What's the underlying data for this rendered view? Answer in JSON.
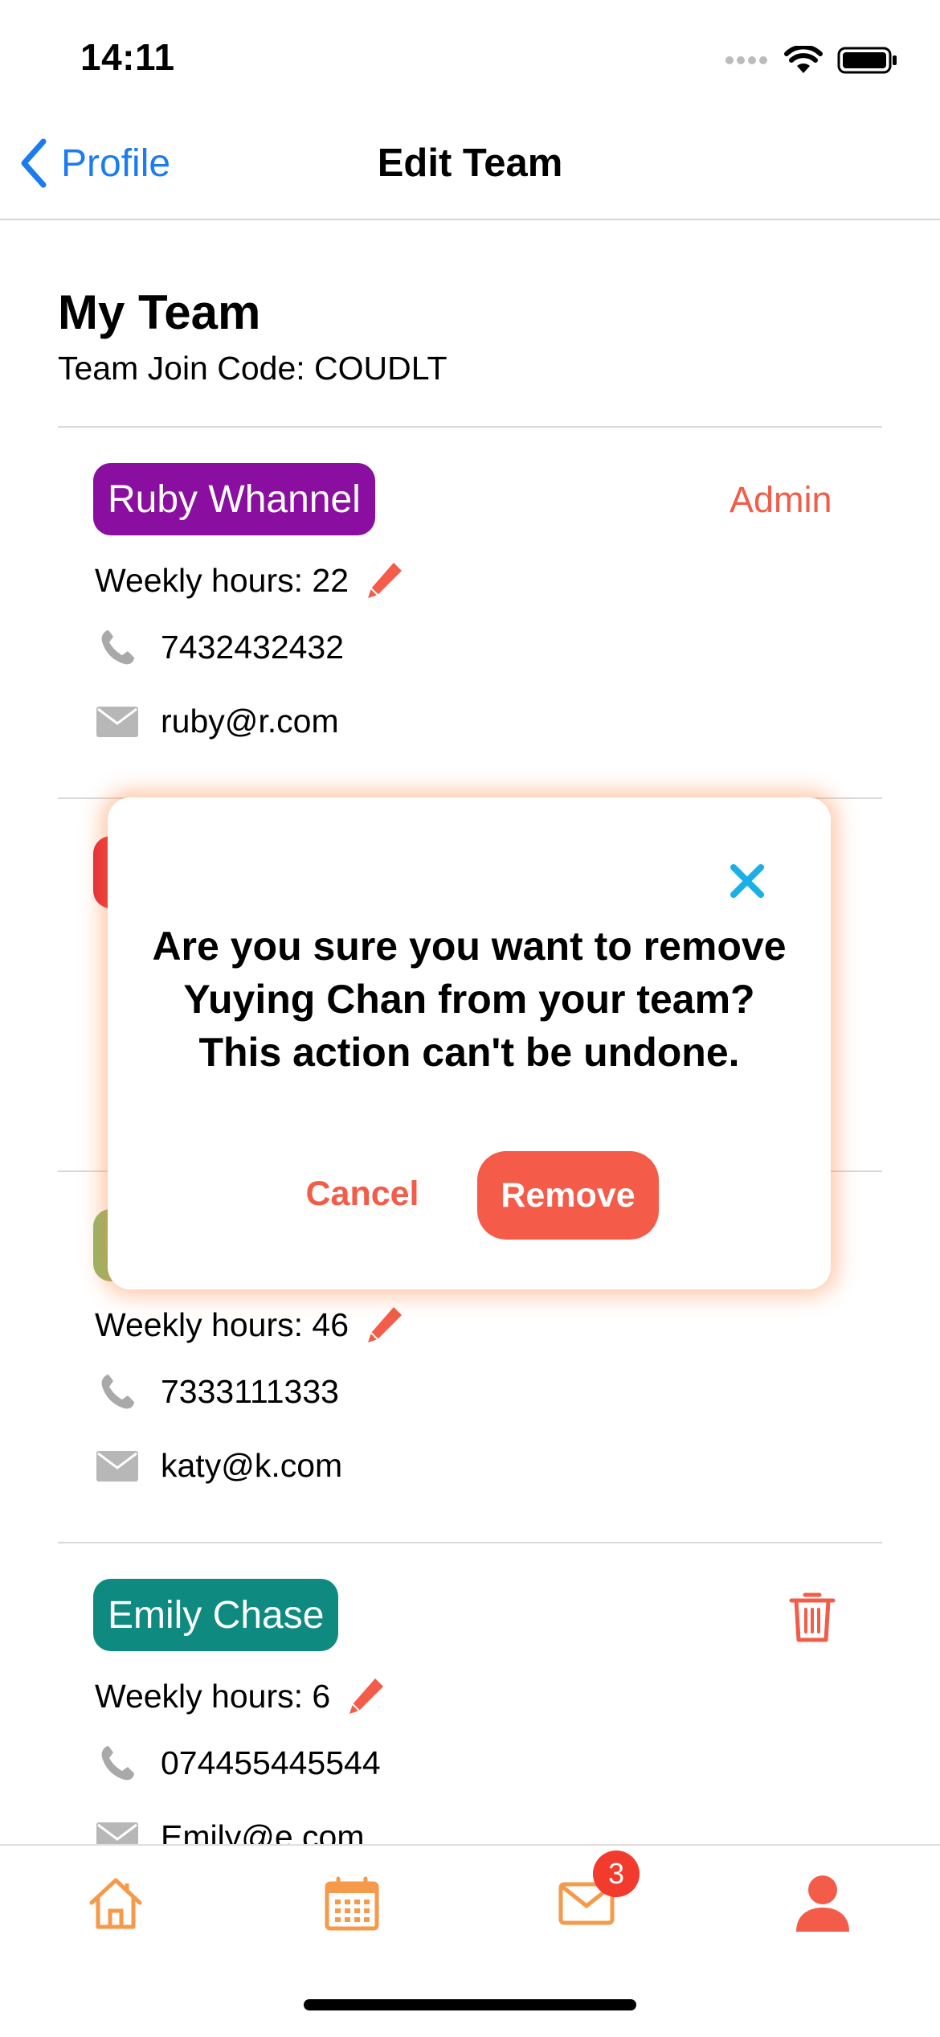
{
  "status_bar": {
    "time": "14:11"
  },
  "nav": {
    "back_label": "Profile",
    "title": "Edit Team"
  },
  "team": {
    "title": "My Team",
    "join_code": "Team Join Code: COUDLT"
  },
  "members": [
    {
      "name": "Ruby Whannel",
      "color": "#8a0fa0",
      "role": "Admin",
      "hours": "Weekly hours: 22",
      "phone": "7432432432",
      "email": "ruby@r.com"
    },
    {
      "name": "",
      "color": "#e4283a"
    },
    {
      "name": "",
      "color": "#8fb86a",
      "hours": "Weekly hours: 46",
      "phone": "7333111333",
      "email": "katy@k.com"
    },
    {
      "name": "Emily Chase",
      "color": "#0f8a80",
      "hours": "Weekly hours: 6",
      "phone": "074455445544",
      "email": "Emily@e.com"
    }
  ],
  "modal": {
    "message": "Are you sure you want to remove\nYuying Chan from your team?\nThis action can't be undone.",
    "cancel_label": "Cancel",
    "remove_label": "Remove"
  },
  "tabbar": {
    "items": [
      {
        "icon": "home-icon"
      },
      {
        "icon": "calendar-icon"
      },
      {
        "icon": "mail-icon",
        "badge": "3"
      },
      {
        "icon": "person-icon",
        "active": true
      }
    ]
  },
  "colors": {
    "accent": "#f25c48",
    "link": "#1a7cf0",
    "tab_orange": "#f59a4a",
    "close": "#1ab0e6"
  }
}
